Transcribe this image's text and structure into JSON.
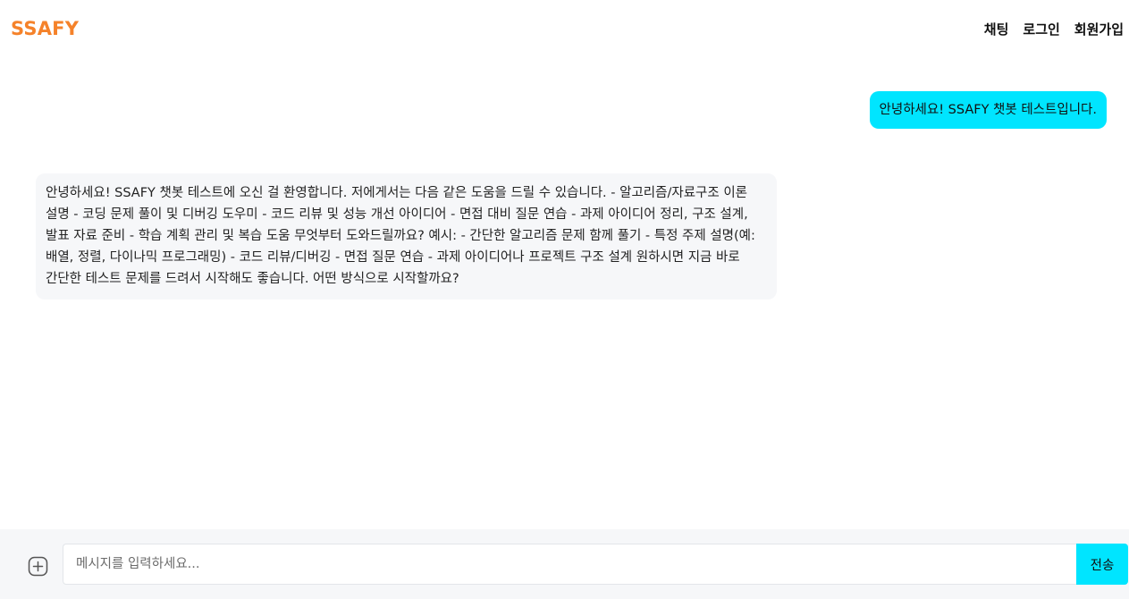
{
  "header": {
    "logo": "SSAFY",
    "nav": {
      "chat": "채팅",
      "login": "로그인",
      "signup": "회원가입"
    }
  },
  "messages": {
    "user": "안녕하세요! SSAFY 챗봇 테스트입니다.",
    "bot": "안녕하세요! SSAFY 챗봇 테스트에 오신 걸 환영합니다. 저에게서는 다음 같은 도움을 드릴 수 있습니다. - 알고리즘/자료구조 이론 설명 - 코딩 문제 풀이 및 디버깅 도우미 - 코드 리뷰 및 성능 개선 아이디어 - 면접 대비 질문 연습 - 과제 아이디어 정리, 구조 설계, 발표 자료 준비 - 학습 계획 관리 및 복습 도움 무엇부터 도와드릴까요? 예시: - 간단한 알고리즘 문제 함께 풀기 - 특정 주제 설명(예: 배열, 정렬, 다이나믹 프로그래밍) - 코드 리뷰/디버깅 - 면접 질문 연습 - 과제 아이디어나 프로젝트 구조 설계 원하시면 지금 바로 간단한 테스트 문제를 드려서 시작해도 좋습니다. 어떤 방식으로 시작할까요?"
  },
  "composer": {
    "placeholder": "메시지를 입력하세요...",
    "value": "",
    "send_label": "전송",
    "attach_icon": "plus-circle-icon"
  },
  "colors": {
    "brand": "#f5822a",
    "accent": "#00e5ff",
    "bot_bubble": "#f6f7f9",
    "input_bar": "#f6f7f9"
  }
}
